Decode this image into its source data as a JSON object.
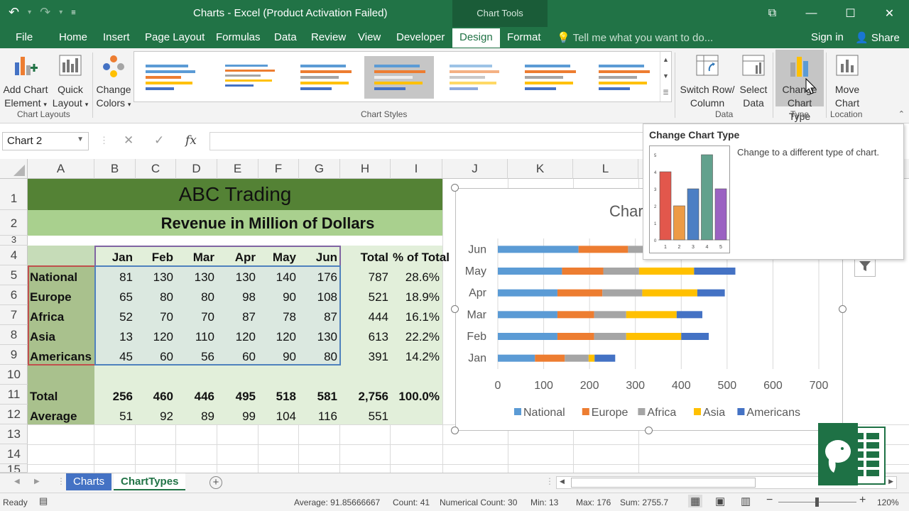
{
  "app": {
    "title": "Charts - Excel (Product Activation Failed)",
    "context_tools": "Chart Tools"
  },
  "tabs": [
    "File",
    "Home",
    "Insert",
    "Page Layout",
    "Formulas",
    "Data",
    "Review",
    "View",
    "Developer",
    "Design",
    "Format"
  ],
  "active_tab": "Design",
  "tell_me": "Tell me what you want to do...",
  "sign_in": "Sign in",
  "share": "Share",
  "ribbon": {
    "add_chart_element": [
      "Add Chart",
      "Element"
    ],
    "quick_layout": [
      "Quick",
      "Layout"
    ],
    "change_colors": [
      "Change",
      "Colors"
    ],
    "chart_layouts": "Chart Layouts",
    "chart_styles": "Chart Styles",
    "switch_row_column": [
      "Switch Row/",
      "Column"
    ],
    "select_data": [
      "Select",
      "Data"
    ],
    "data_group": "Data",
    "change_chart_type": [
      "Change",
      "Chart Type"
    ],
    "type_group": "Type",
    "move_chart": [
      "Move",
      "Chart"
    ],
    "location_group": "Location"
  },
  "name_box": "Chart 2",
  "columns": [
    "A",
    "B",
    "C",
    "D",
    "E",
    "F",
    "G",
    "H",
    "I",
    "J",
    "K",
    "L"
  ],
  "rows": [
    "1",
    "2",
    "3",
    "4",
    "5",
    "6",
    "7",
    "8",
    "9",
    "10",
    "11",
    "12",
    "13",
    "14",
    "15"
  ],
  "sheet": {
    "title": "ABC Trading",
    "subtitle": "Revenue in Million of Dollars",
    "months": [
      "Jan",
      "Feb",
      "Mar",
      "Apr",
      "May",
      "Jun"
    ],
    "total_header": "Total",
    "pct_header": "% of Total",
    "regions": [
      {
        "name": "National",
        "values": [
          "81",
          "130",
          "130",
          "130",
          "140",
          "176"
        ],
        "total": "787",
        "pct": "28.6%"
      },
      {
        "name": "Europe",
        "values": [
          "65",
          "80",
          "80",
          "98",
          "90",
          "108"
        ],
        "total": "521",
        "pct": "18.9%"
      },
      {
        "name": "Africa",
        "values": [
          "52",
          "70",
          "70",
          "87",
          "78",
          "87"
        ],
        "total": "444",
        "pct": "16.1%"
      },
      {
        "name": "Asia",
        "values": [
          "13",
          "120",
          "110",
          "120",
          "120",
          "130"
        ],
        "total": "613",
        "pct": "22.2%"
      },
      {
        "name": "Americans",
        "values": [
          "45",
          "60",
          "56",
          "60",
          "90",
          "80"
        ],
        "total": "391",
        "pct": "14.2%"
      }
    ],
    "total_row": {
      "label": "Total",
      "values": [
        "256",
        "460",
        "446",
        "495",
        "518",
        "581"
      ],
      "total": "2,756",
      "pct": "100.0%"
    },
    "avg_row": {
      "label": "Average",
      "values": [
        "51",
        "92",
        "89",
        "99",
        "104",
        "116"
      ],
      "total": "551"
    }
  },
  "chart_data": {
    "type": "bar",
    "orientation": "horizontal",
    "stacked": true,
    "title": "Char",
    "categories": [
      "Jan",
      "Feb",
      "Mar",
      "Apr",
      "May",
      "Jun"
    ],
    "series": [
      {
        "name": "National",
        "color": "#5b9bd5",
        "values": [
          81,
          130,
          130,
          130,
          140,
          176
        ]
      },
      {
        "name": "Europe",
        "color": "#ed7d31",
        "values": [
          65,
          80,
          80,
          98,
          90,
          108
        ]
      },
      {
        "name": "Africa",
        "color": "#a5a5a5",
        "values": [
          52,
          70,
          70,
          87,
          78,
          87
        ]
      },
      {
        "name": "Asia",
        "color": "#ffc000",
        "values": [
          13,
          120,
          110,
          120,
          120,
          130
        ]
      },
      {
        "name": "Americans",
        "color": "#4472c4",
        "values": [
          45,
          60,
          56,
          60,
          90,
          80
        ]
      }
    ],
    "xlim": [
      0,
      700
    ],
    "xticks": [
      "0",
      "100",
      "200",
      "300",
      "400",
      "500",
      "600",
      "700"
    ],
    "grid": true,
    "legend": "bottom"
  },
  "tooltip": {
    "title": "Change Chart Type",
    "description": "Change to a different type of chart.",
    "preview": {
      "labels": [
        "1",
        "2",
        "3",
        "4",
        "5"
      ],
      "values": [
        4,
        2,
        3,
        5,
        3
      ],
      "colors": [
        "#e2574c",
        "#ed9b45",
        "#4c7fc4",
        "#62a18d",
        "#9b62c2"
      ]
    }
  },
  "sheet_tabs": [
    "Charts",
    "ChartTypes"
  ],
  "status": {
    "ready": "Ready",
    "average": "Average: 91.85666667",
    "count": "Count: 41",
    "numerical_count": "Numerical Count: 30",
    "min": "Min: 13",
    "max": "Max: 176",
    "sum": "Sum: 2755.7",
    "zoom": "120%"
  },
  "colors": {
    "excel_green": "#217346",
    "title_fill": "#548235",
    "subtitle_fill": "#a9d08e",
    "light_fill": "#e2efda",
    "sheet_tab_blue": "#4472c4"
  }
}
